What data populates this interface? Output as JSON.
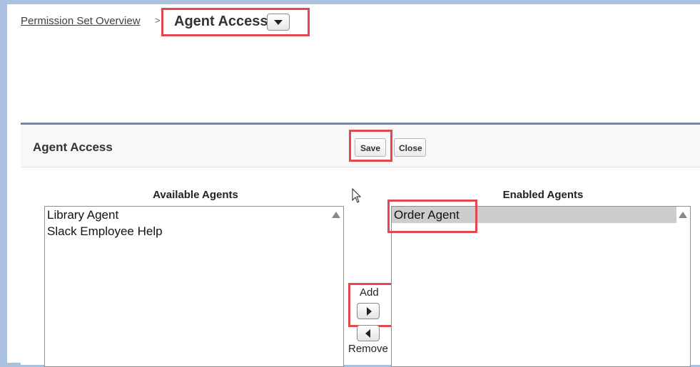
{
  "breadcrumb": {
    "parent_label": "Permission Set Overview",
    "separator": ">",
    "current_title": "Agent Access"
  },
  "panel": {
    "title": "Agent Access",
    "save_label": "Save",
    "close_label": "Close"
  },
  "available": {
    "label": "Available Agents",
    "items": [
      "Library Agent",
      "Slack Employee Help"
    ]
  },
  "enabled": {
    "label": "Enabled Agents",
    "items": [
      "Order Agent"
    ],
    "selected": "Order Agent"
  },
  "controls": {
    "add_label": "Add",
    "remove_label": "Remove"
  },
  "icons": {
    "dropdown": "chevron-down-icon",
    "add": "arrow-right-icon",
    "remove": "arrow-left-icon",
    "scroll": "scroll-up-icon",
    "cursor": "mouse-pointer-icon"
  },
  "colors": {
    "highlight": "#e5474f",
    "panel_border": "#79839a",
    "selected_row": "#cdcdcd",
    "background": "#a9c1de"
  }
}
